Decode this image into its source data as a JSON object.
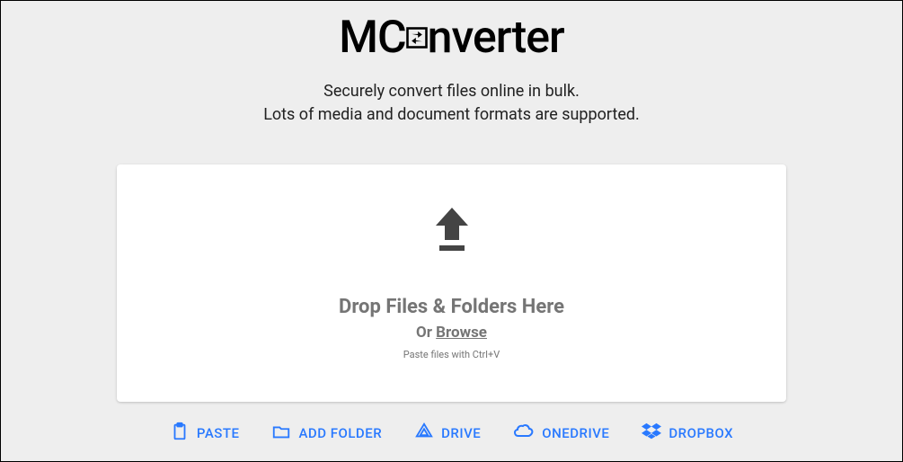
{
  "logo": {
    "pre": "MC",
    "post": "nverter"
  },
  "tagline": {
    "line1": "Securely convert files online in bulk.",
    "line2": "Lots of media and document formats are supported."
  },
  "dropzone": {
    "title": "Drop Files & Folders Here",
    "or": "Or ",
    "browse": "Browse",
    "hint": "Paste files with Ctrl+V"
  },
  "actions": {
    "paste": "PASTE",
    "addFolder": "ADD FOLDER",
    "drive": "DRIVE",
    "onedrive": "ONEDRIVE",
    "dropbox": "DROPBOX"
  },
  "colors": {
    "accent": "#2979ff",
    "gray": "#757575"
  }
}
